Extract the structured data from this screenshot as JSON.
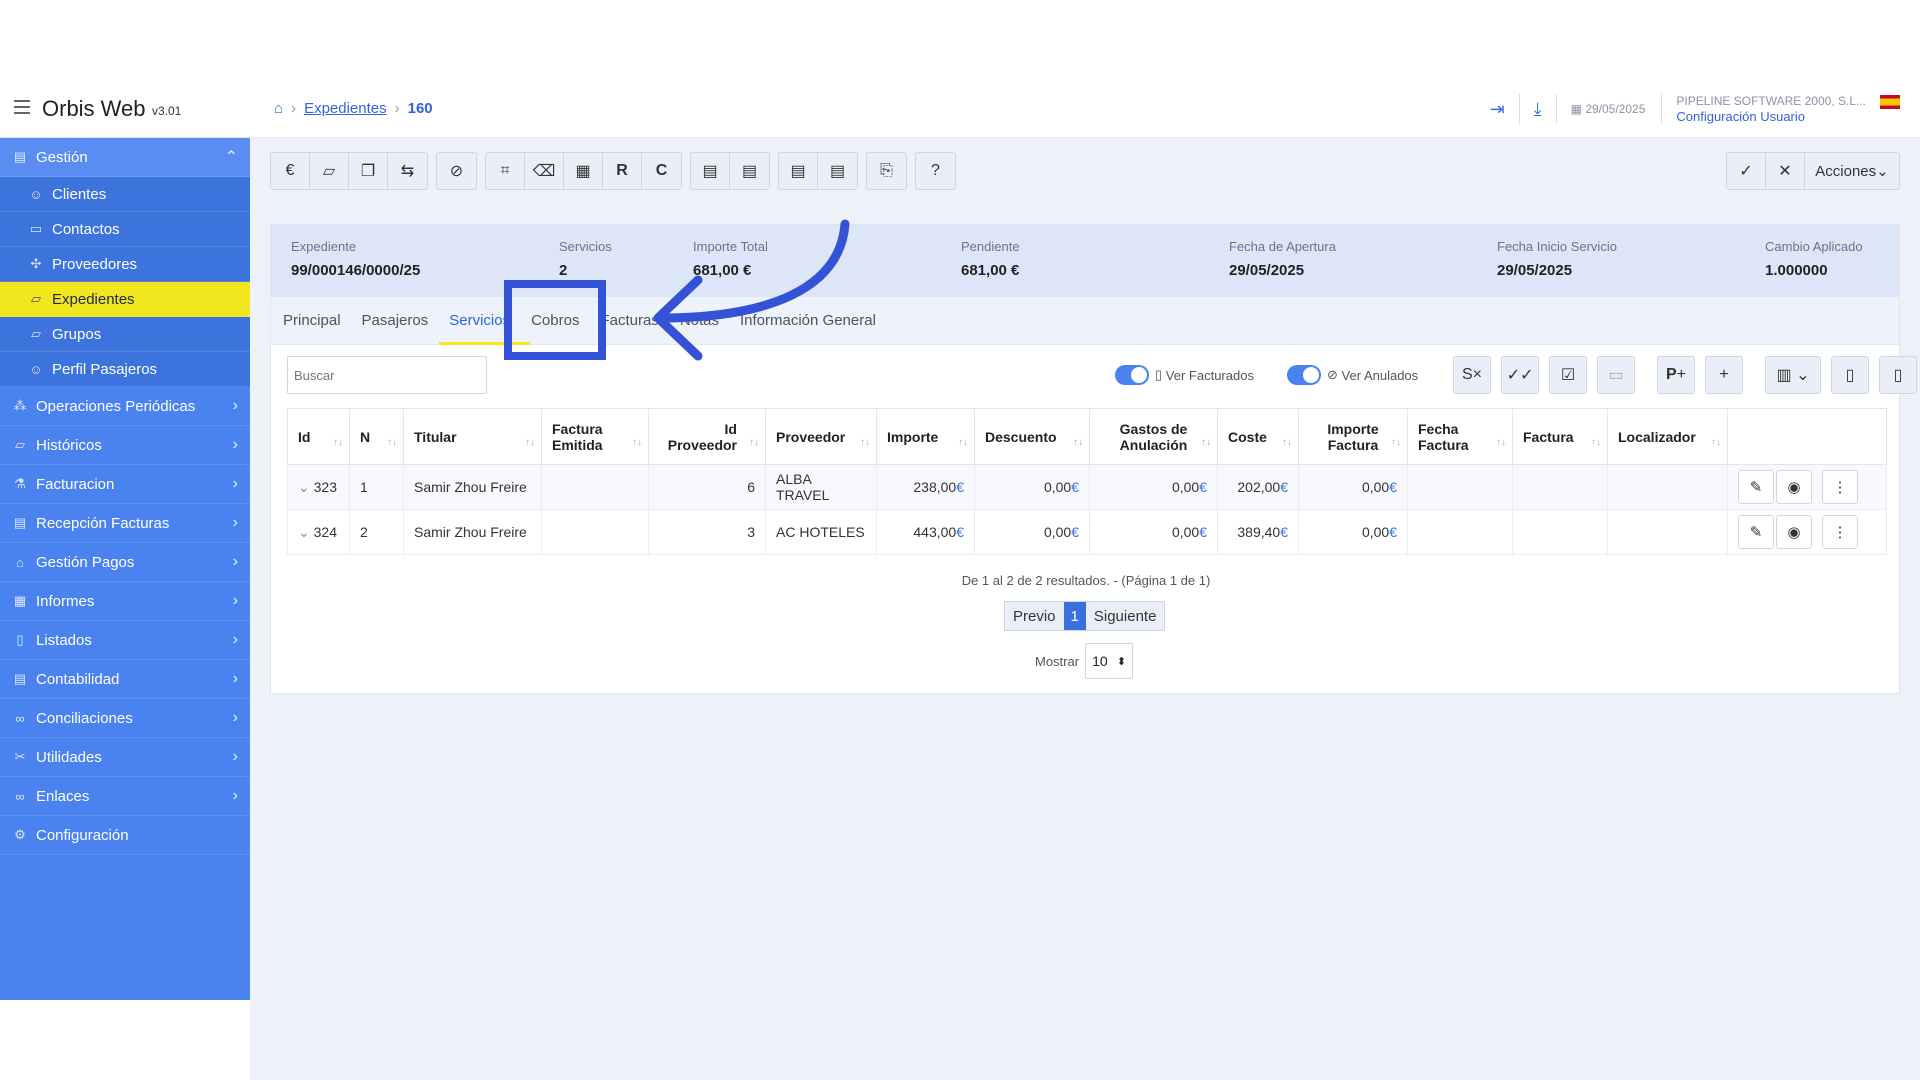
{
  "app": {
    "title": "Orbis Web",
    "version": "v3.01"
  },
  "breadcrumb": {
    "home_icon": "home-icon",
    "link": "Expedientes",
    "current": "160"
  },
  "header": {
    "date": "29/05/2025",
    "company": "PIPELINE SOFTWARE 2000, S.L...",
    "config_link": "Configuración Usuario"
  },
  "sidebar": {
    "gestion": "Gestión",
    "sub": [
      "Clientes",
      "Contactos",
      "Proveedores",
      "Expedientes",
      "Grupos",
      "Perfil Pasajeros"
    ],
    "items": [
      "Operaciones Periódicas",
      "Históricos",
      "Facturacion",
      "Recepción Facturas",
      "Gestión Pagos",
      "Informes",
      "Listados",
      "Contabilidad",
      "Conciliaciones",
      "Utilidades",
      "Enlaces",
      "Configuración"
    ]
  },
  "toolbar": {
    "r": "R",
    "c": "C",
    "acciones": "Acciones"
  },
  "summary": [
    {
      "label": "Expediente",
      "value": "99/000146/0000/25"
    },
    {
      "label": "Servicios",
      "value": "2"
    },
    {
      "label": "Importe Total",
      "value": "681,00 €"
    },
    {
      "label": "Pendiente",
      "value": "681,00 €"
    },
    {
      "label": "Fecha de Apertura",
      "value": "29/05/2025"
    },
    {
      "label": "Fecha Inicio Servicio",
      "value": "29/05/2025"
    },
    {
      "label": "Cambio Aplicado",
      "value": "1.000000"
    }
  ],
  "tabs": [
    "Principal",
    "Pasajeros",
    "Servicios",
    "Cobros",
    "Facturas",
    "Notas",
    "Información General"
  ],
  "filters": {
    "search_placeholder": "Buscar",
    "ver_facturados": "Ver Facturados",
    "ver_anulados": "Ver Anulados"
  },
  "table": {
    "headers": [
      "Id",
      "N",
      "Titular",
      "Factura Emitida",
      "Id Proveedor",
      "Proveedor",
      "Importe",
      "Descuento",
      "Gastos de Anulación",
      "Coste",
      "Importe Factura",
      "Fecha Factura",
      "Factura",
      "Localizador"
    ],
    "rows": [
      {
        "id": "323",
        "n": "1",
        "titular": "Samir Zhou Freire",
        "id_prov": "6",
        "proveedor": "ALBA TRAVEL",
        "importe": "238,00",
        "descuento": "0,00",
        "gastos": "0,00",
        "coste": "202,00",
        "imp_factura": "0,00"
      },
      {
        "id": "324",
        "n": "2",
        "titular": "Samir Zhou Freire",
        "id_prov": "3",
        "proveedor": "AC HOTELES",
        "importe": "443,00",
        "descuento": "0,00",
        "gastos": "0,00",
        "coste": "389,40",
        "imp_factura": "0,00"
      }
    ],
    "currency": "€"
  },
  "pagination": {
    "info": "De 1 al 2 de 2 resultados. - (Página 1 de 1)",
    "prev": "Previo",
    "page": "1",
    "next": "Siguiente",
    "show_label": "Mostrar",
    "show_value": "10"
  },
  "annotation": {
    "color": "#3452d6"
  }
}
